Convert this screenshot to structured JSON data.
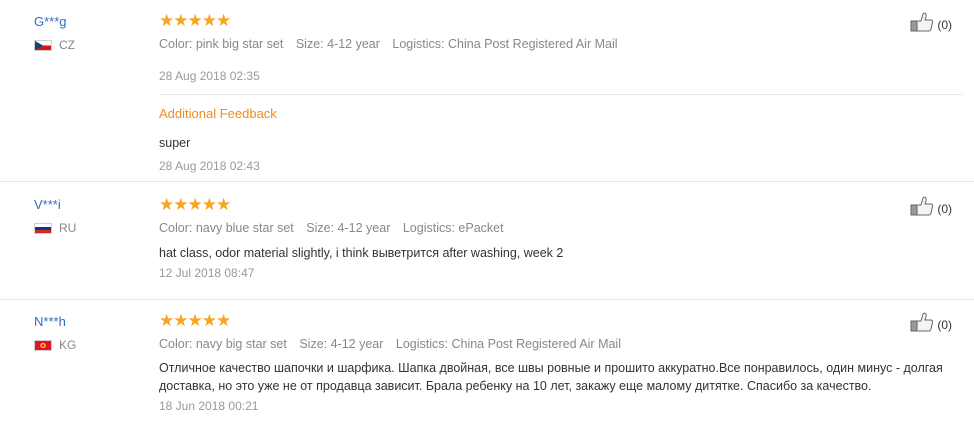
{
  "reviews": [
    {
      "username": "G***g",
      "country": "CZ",
      "stars": "★★★★★",
      "color": "Color: pink big star set",
      "size": "Size: 4-12 year",
      "logistics": "Logistics: China Post Registered Air Mail",
      "text": "",
      "date": "28 Aug 2018 02:35",
      "additional_title": "Additional Feedback",
      "additional_text": "super",
      "additional_date": "28 Aug 2018 02:43",
      "helpful_count": "(0)"
    },
    {
      "username": "V***i",
      "country": "RU",
      "stars": "★★★★★",
      "color": "Color: navy blue star set",
      "size": "Size: 4-12 year",
      "logistics": "Logistics: ePacket",
      "text": "hat class, odor material slightly, i think выветрится after washing, week 2",
      "date": "12 Jul 2018 08:47",
      "helpful_count": "(0)"
    },
    {
      "username": "N***h",
      "country": "KG",
      "stars": "★★★★★",
      "color": "Color: navy big star set",
      "size": "Size: 4-12 year",
      "logistics": "Logistics: China Post Registered Air Mail",
      "text": "Отличное качество шапочки и шарфика. Шапка двойная, все швы ровные и прошито аккуратно.Все понравилось, один минус - долгая доставка, но это уже не от продавца зависит. Брала ребенку на 10 лет, закажу еще малому дитятке. Спасибо за качество.",
      "date": "18 Jun 2018 00:21",
      "helpful_count": "(0)"
    }
  ],
  "colors": {
    "username": "#2a6fbf",
    "star": "#f5a623",
    "additional_feedback": "#f08c1f"
  },
  "icons": {
    "helpful": "thumbs-up-icon",
    "star": "star-icon"
  }
}
